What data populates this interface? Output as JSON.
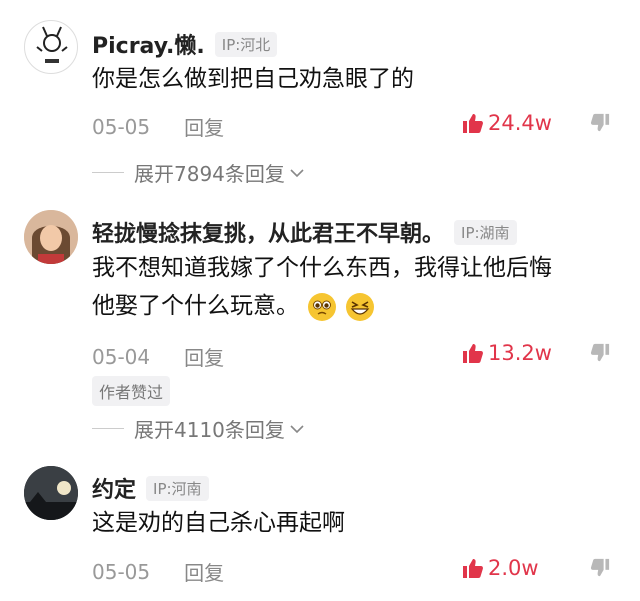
{
  "comments": [
    {
      "user": "Picray.懒.",
      "ip": "IP:河北",
      "text_lines": [
        "你是怎么做到把自己劝急眼了的"
      ],
      "date": "05-05",
      "reply_label": "回复",
      "likes": "24.4w",
      "expand": "展开7894条回复"
    },
    {
      "user": "轻拢慢捻抹复挑，从此君王不早朝。",
      "ip": "IP:湖南",
      "text_lines": [
        "我不想知道我嫁了个什么东西，我得让他后悔",
        "他娶了个什么玩意。"
      ],
      "emojis": [
        "pleading-face-emoji",
        "grinning-squint-emoji"
      ],
      "date": "05-04",
      "reply_label": "回复",
      "likes": "13.2w",
      "author_liked": "作者赞过",
      "expand": "展开4110条回复"
    },
    {
      "user": "约定",
      "ip": "IP:河南",
      "text_lines": [
        "这是劝的自己杀心再起啊"
      ],
      "date": "05-05",
      "reply_label": "回复",
      "likes": "2.0w"
    }
  ],
  "colors": {
    "accent": "#e1354a",
    "muted": "#999999",
    "tag_bg": "#f1f1f3"
  },
  "icons": [
    "thumbs-up-icon",
    "thumbs-down-icon",
    "chevron-down-icon"
  ]
}
